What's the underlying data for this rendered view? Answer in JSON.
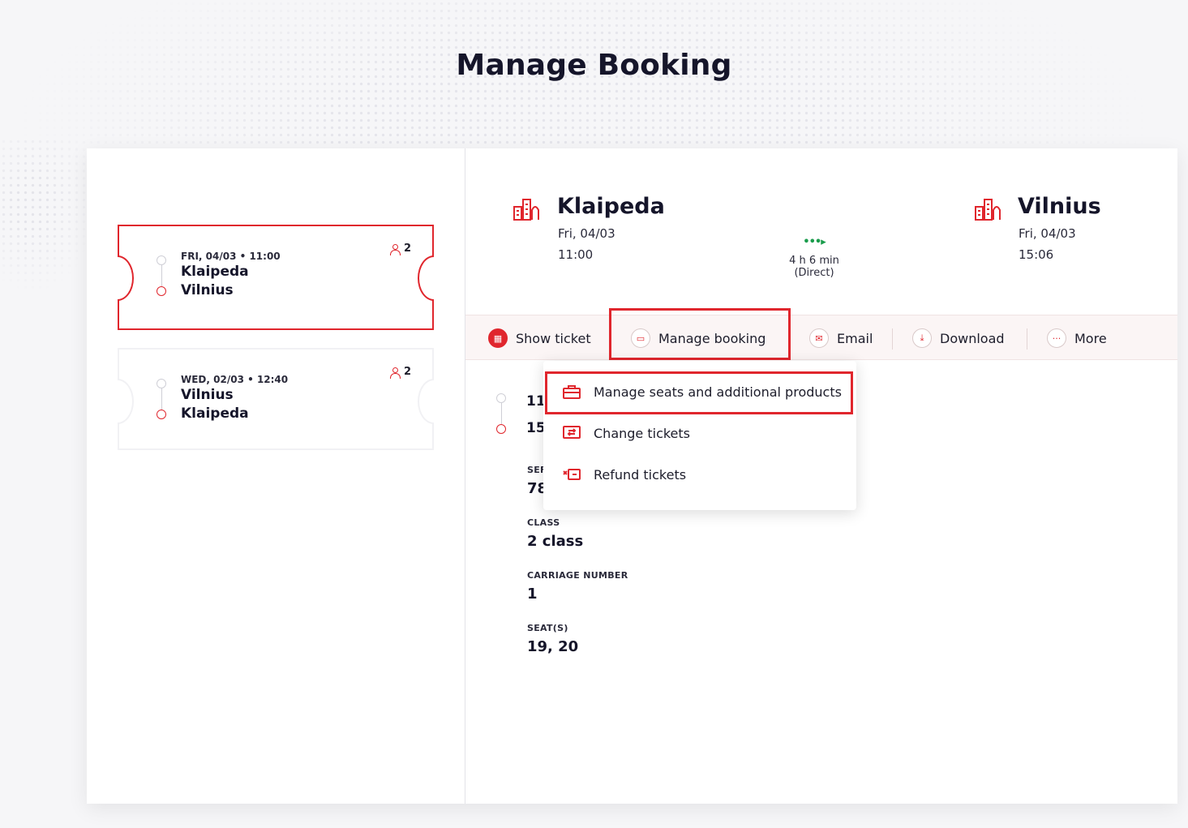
{
  "page": {
    "title": "Manage Booking"
  },
  "trips": [
    {
      "date": "FRI, 04/03 • 11:00",
      "from": "Klaipeda",
      "to": "Vilnius",
      "passengers": "2",
      "active": true
    },
    {
      "date": "WED, 02/03 • 12:40",
      "from": "Vilnius",
      "to": "Klaipeda",
      "passengers": "2",
      "active": false
    }
  ],
  "journey": {
    "origin": {
      "name": "Klaipeda",
      "date": "Fri, 04/03",
      "time": "11:00"
    },
    "destination": {
      "name": "Vilnius",
      "date": "Fri, 04/03",
      "time": "15:06"
    },
    "duration": "4 h 6 min",
    "type": "(Direct)"
  },
  "toolbar": {
    "show_ticket": "Show ticket",
    "manage_booking": "Manage booking",
    "email": "Email",
    "download": "Download",
    "more": "More"
  },
  "menu": {
    "items": [
      {
        "label": "Manage seats and additional products",
        "icon": "briefcase-icon"
      },
      {
        "label": "Change tickets",
        "icon": "ticket-change-icon"
      },
      {
        "label": "Refund tickets",
        "icon": "ticket-refund-icon"
      }
    ]
  },
  "segment": {
    "depart_time": "11:",
    "arrive_time": "15:",
    "service_label": "SEF",
    "service_value": "78",
    "class_label": "CLASS",
    "class_value": "2 class",
    "carriage_label": "CARRIAGE NUMBER",
    "carriage_value": "1",
    "seats_label": "SEAT(S)",
    "seats_value": "19, 20"
  },
  "colors": {
    "accent": "#e0262d",
    "green": "#1a9c4c"
  }
}
